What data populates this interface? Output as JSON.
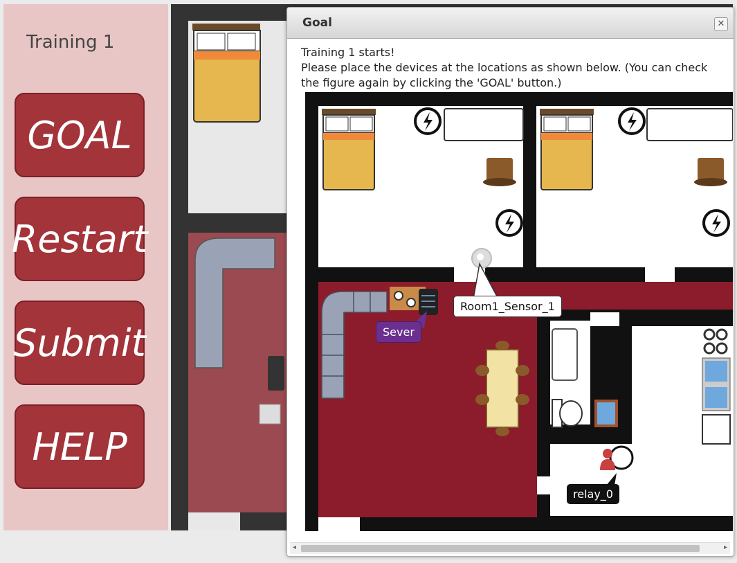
{
  "sidebar": {
    "title": "Training 1",
    "buttons": [
      "GOAL",
      "Restart",
      "Submit",
      "HELP"
    ]
  },
  "dialog": {
    "title": "Goal",
    "close_icon": "close-icon",
    "line1": "Training 1 starts!",
    "line2": "Please place the devices at the locations as shown below. (You can check the figure again by clicking the 'GOAL' button.)"
  },
  "devices": {
    "sensor_label": "Room1_Sensor_1",
    "server_label": "Sever",
    "relay_label": "relay_0"
  },
  "colors": {
    "sidebar_bg": "#e8c6c6",
    "button": "#a3343a",
    "floor_red": "#8c1c2c",
    "wall": "#111111",
    "server_callout": "#6b2f8f"
  }
}
